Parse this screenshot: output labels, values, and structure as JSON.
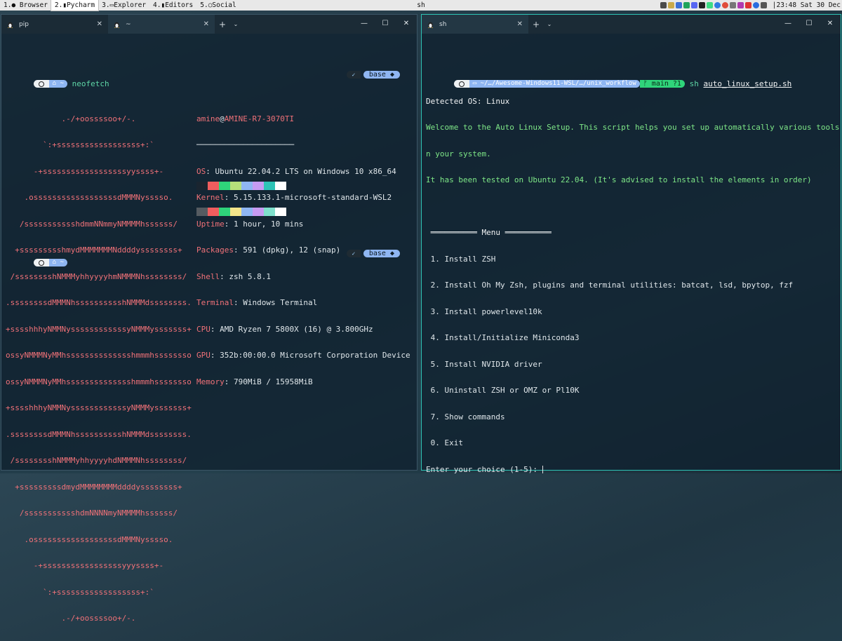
{
  "topbar": {
    "workspaces": [
      {
        "label": "1.● Browser",
        "active": false
      },
      {
        "label": "2.▮Pycharm",
        "active": true
      },
      {
        "label": "3.▭Explorer",
        "active": false
      },
      {
        "label": "4.▮Editors",
        "active": false
      },
      {
        "label": "5.○Social",
        "active": false
      }
    ],
    "window_title": "sh",
    "clock": "|23:48 Sat 30 Dec"
  },
  "left_window": {
    "tabs": [
      {
        "label": "pip",
        "active": false
      },
      {
        "label": "~",
        "active": true
      }
    ],
    "controls": [
      "—",
      "☐",
      "✕"
    ],
    "prompt_dir": "~",
    "command": "neofetch",
    "right_prompt_check": "✓",
    "right_prompt_env": "base ◆",
    "logo_lines": [
      "            .-/+oossssoo+/-.",
      "        `:+ssssssssssssssssss+:`",
      "      -+ssssssssssssssssssyyssss+-",
      "    .ossssssssssssssssssdMMMNysssso.",
      "   /ssssssssssshdmmNNmmyNMMMMhssssss/",
      "  +ssssssssshmydMMMMMMMNddddyssssssss+",
      " /sssssssshNMMMyhhyyyyhmNMMMNhssssssss/",
      ".ssssssssdMMMNhsssssssssshNMMMdssssssss.",
      "+sssshhhyNMMNyssssssssssssyNMMMysssssss+",
      "ossyNMMMNyMMhsssssssssssssshmmmhssssssso",
      "ossyNMMMNyMMhsssssssssssssshmmmhssssssso",
      "+sssshhhyNMMNyssssssssssssyNMMMysssssss+",
      ".ssssssssdMMMNhsssssssssshNMMMdssssssss.",
      " /sssssssshNMMMyhhyyyyhdNMMMNhssssssss/",
      "  +sssssssssdmydMMMMMMMMddddyssssssss+",
      "   /ssssssssssshdmNNNNmyNMMMMhssssss/",
      "    .ossssssssssssssssssdMMMNysssso.",
      "      -+sssssssssssssssssyyyssss+-",
      "        `:+ssssssssssssssssss+:`",
      "            .-/+oossssoo+/-."
    ],
    "info": {
      "user": "amine",
      "at": "@",
      "host": "AMINE-R7-3070TI",
      "separator": "─────────────────────",
      "rows": [
        {
          "key": "OS",
          "value": ": Ubuntu 22.04.2 LTS on Windows 10 x86_64"
        },
        {
          "key": "Kernel",
          "value": ": 5.15.133.1-microsoft-standard-WSL2"
        },
        {
          "key": "Uptime",
          "value": ": 1 hour, 10 mins"
        },
        {
          "key": "Packages",
          "value": ": 591 (dpkg), 12 (snap)"
        },
        {
          "key": "Shell",
          "value": ": zsh 5.8.1"
        },
        {
          "key": "Terminal",
          "value": ": Windows Terminal"
        },
        {
          "key": "CPU",
          "value": ": AMD Ryzen 7 5800X (16) @ 3.800GHz"
        },
        {
          "key": "GPU",
          "value": ": 352b:00:00.0 Microsoft Corporation Device"
        },
        {
          "key": "Memory",
          "value": ": 790MiB / 15958MiB"
        }
      ]
    },
    "palette_top": [
      "#1a2530",
      "#f05d5e",
      "#2fd47a",
      "#b6e07a",
      "#8fb6f2",
      "#c79bf2",
      "#2ec4b6",
      "#ffffff"
    ],
    "palette_bottom": [
      "#555b61",
      "#f05d5e",
      "#2fd47a",
      "#f4e58a",
      "#8fb6f2",
      "#c79bf2",
      "#7fe0cc",
      "#ffffff"
    ]
  },
  "right_window": {
    "tabs": [
      {
        "label": "sh",
        "active": true
      }
    ],
    "controls": [
      "—",
      "☐",
      "✕"
    ],
    "prompt_path": "~/…/Awesome-Windows11-WSL/…/unix_workflow",
    "git_status": "main ?1",
    "command_prefix": "sh ",
    "command_arg": "auto_linux_setup.sh",
    "detected": "Detected OS: Linux",
    "welcome_1": "Welcome to the Auto Linux Setup. This script helps you set up automatically various tools o",
    "welcome_2": "n your system.",
    "tested": "It has been tested on Ubuntu 22.04. (It's advised to install the elements in order)",
    "menu_header": " ══════════ Menu ══════════",
    "menu_items": [
      " 1. Install ZSH",
      " 2. Install Oh My Zsh, plugins and terminal utilities: batcat, lsd, bpytop, fzf",
      " 3. Install powerlevel10k",
      " 4. Install/Initialize Miniconda3",
      " 5. Install NVIDIA driver",
      " 6. Uninstall ZSH or OMZ or Pl10K",
      " 7. Show commands",
      " 0. Exit"
    ],
    "choice_prompt": "Enter your choice (1-5): "
  }
}
